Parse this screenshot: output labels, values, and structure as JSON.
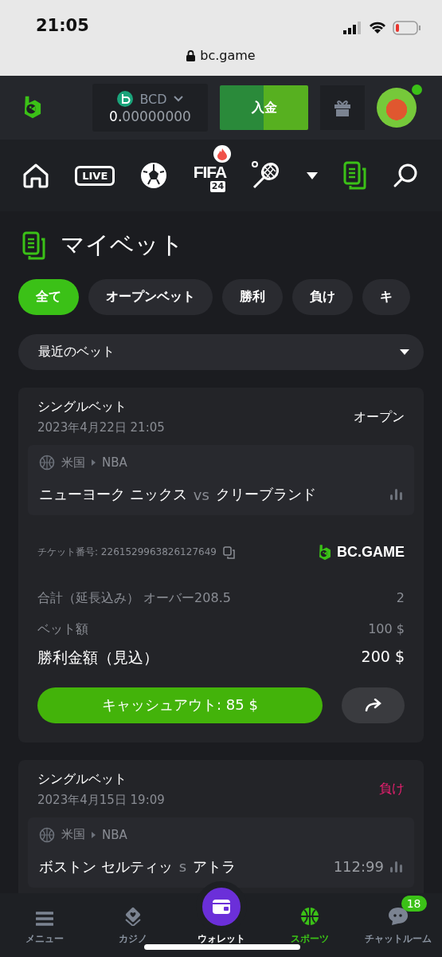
{
  "status_bar": {
    "time": "21:05",
    "url": "bc.game"
  },
  "header": {
    "currency": "BCD",
    "balance_whole": "0.",
    "balance_fraction": "00000000",
    "deposit_button": "入金",
    "avatar_online": true
  },
  "sport_nav": {
    "items": [
      {
        "kind": "home",
        "selected": false
      },
      {
        "kind": "live",
        "label": "LIVE",
        "selected": false
      },
      {
        "kind": "soccer",
        "selected": false
      },
      {
        "kind": "fifa",
        "label": "FIFA",
        "sublabel": "24",
        "selected": false
      },
      {
        "kind": "tennis",
        "selected": false
      },
      {
        "kind": "more",
        "selected": false
      },
      {
        "kind": "mybets",
        "selected": true
      },
      {
        "kind": "search",
        "selected": false
      }
    ]
  },
  "page": {
    "title": "マイベット",
    "filters": [
      {
        "label": "全て",
        "selected": true
      },
      {
        "label": "オープンベット",
        "selected": false
      },
      {
        "label": "勝利",
        "selected": false
      },
      {
        "label": "負け",
        "selected": false
      },
      {
        "label": "キ",
        "selected": false
      }
    ],
    "dropdown": {
      "value": "最近のベット"
    }
  },
  "bets": [
    {
      "type": "シングルベット",
      "date": "2023年4月22日 21:05",
      "status": "オープン",
      "color": "#ffffff",
      "country": "米国",
      "league": "NBA",
      "home": "ニューヨーク ニックス",
      "vs": "vs",
      "away": "クリーブランド",
      "ticket_label": "チケット番号: 2261529963826127649",
      "brand": "BC.GAME",
      "market": "合計（延長込み） オーバー208.5",
      "odds": "2",
      "stake_label": "ベット額",
      "stake": "100 $",
      "payout_label": "勝利金額（見込）",
      "payout": "200 $",
      "cashout": "キャッシュアウト: 85 $"
    },
    {
      "type": "シングルベット",
      "date": "2023年4月15日 19:09",
      "status": "負け",
      "color": "#ed1f71",
      "country": "米国",
      "league": "NBA",
      "home": "ボストン セルティッ",
      "vs": "s",
      "away": "アトラ",
      "score": "112:99"
    }
  ],
  "bottom_nav": {
    "items": [
      {
        "kind": "menu",
        "label": "メニュー",
        "selected": false
      },
      {
        "kind": "casino",
        "label": "カジノ",
        "selected": false
      },
      {
        "kind": "wallet",
        "label": "ウォレット",
        "selected": false
      },
      {
        "kind": "sports",
        "label": "スポーツ",
        "selected": true
      },
      {
        "kind": "chat",
        "label": "チャットルーム",
        "selected": false,
        "badge": "18"
      }
    ]
  }
}
